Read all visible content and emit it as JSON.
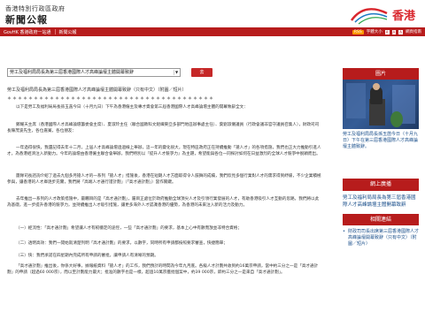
{
  "header": {
    "gov_name": "香港特別行政區政府",
    "section_title": "新聞公報",
    "brand_text": "香港"
  },
  "nav": {
    "govhk": "GovHK 香港政府一站通",
    "archive": "新聞公報",
    "rss": "RSS",
    "font_label": "字體大小",
    "sizes": [
      "A",
      "A",
      "A"
    ],
    "lang": "網頁指南"
  },
  "selector": {
    "selected": "勞工及福利局局長為第三屆香港國際人才高峰論壇主體開幕致辭",
    "go_button": "去"
  },
  "article": {
    "headline": "勞工及福利局局長為第三屆香港國際人才高峰論壇主體開幕致辭（只有中文）（附圖／短片）",
    "stars": "＊＊＊＊＊＊＊＊＊＊＊＊＊＊＊＊＊＊＊＊＊＊＊＊＊＊＊＊＊＊＊＊＊＊＊＊＊＊＊",
    "intro": "以下是勞工及福利局局長孫玉菡今日（十月九日）下午為香港僱主及專才資會第三屆香港國際人才高峰論壇主體的開幕致辭全文：",
    "p1": "鄭耀天主席（香港國際人才高峰論壇籌委會主席）、夏淑玲主任（聯合國教科文組織東亞多部門地區辦事處主任）、葉劉淑儀議員（行政會議非官守議員召集人），財政司司長陳茂波先生，各位嘉賓，各位朋友：",
    "p2": "一年過得很快，我還記得去年十二月，上屆人才高峰論壇過過線上舉辦，這一年的變化很大，現在特區政府正在持續推動「搶人才」的各項措施，我們也正大力推動引進人才，為香港經濟注入新動力。今年的論壇由香港僱主聯合會舉辦，我們特別以『提升人才競爭力』為主題，希望能與各位一同探討如何在日益激烈的全球人才競爭中脫穎而出。",
    "p3": "團隊司長諮詢介紹了過去九個多月搶人才的一系列「搶人才」措施後，香港在短期人才方面取得令人鼓舞的成績，我們欣見多個行業對人才的需求得到紓緩，不少企業積極參與，讓香港的人才庫逐步充實，我們將「高端人才通行證計劃」（「高才通計劃」）當作關鍵。",
    "p4": "去年推出一系列的人才政策措施中，最矚目的是「高才通計劃」，屬目正處位於政府推動全球頂尖人才及引領行業發展的人才，有助香港吸引人才互動的思路，我們將以此為基礎，進一步提升香港的競爭力，並持續推出人才吸引措施，讓更多海外人才認識香港的優勢，為香港的未來注入新的活力及動力。",
    "p5": "（一）經流性：「高才通計劃」希望讓人才有較穩定的途徑，一些「高才通計劃」的要求，基本上心中有數而放並非特合資格；",
    "p6": "（二）透明高效：我們一開始就清楚列明「高才通計劃」的要求，以數字，同時所有申請都按照要求審查，快捷簡單；",
    "p7": "（三）快：我們承諾在四星期內完成所有申請的審批，讓申請人有清晰的預期。",
    "p8": "「高才通計劃」推出後，你係大好事，據報紙資料「搶人才」的工作，我們預計的時間為今年九月底。各級人才計劃共收到約16萬宗申請，當中約三分之一是「高才通計劃」的申請（超過60 000宗），而以至計劃能力最大；批准的數字也是一樣，超過10萬宗獲批個案中，約39 000宗，即約三分之一是來自「高才通計劃」。"
  },
  "sidebar": {
    "photo_heading": "圖片",
    "photo_caption": "勞工及福利局局長孫玉菡今日（十月九日）下午在第三屆香港國際人才高峰論壇主體致辭。",
    "online_heading": "網上廣播",
    "online_body": "勞工及福利局局長為第三屆香港國際人才高峰論壇主體開幕致辭",
    "related_heading": "相關連結",
    "related_items": [
      "財政司司長出席第三屆香港國際人才高峰論壇開幕致辭（只有中文）（附圖／短片）"
    ]
  }
}
